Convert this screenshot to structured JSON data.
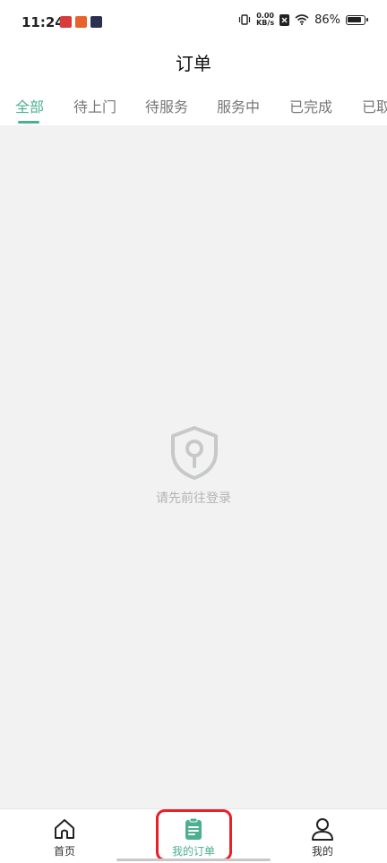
{
  "status_bar": {
    "time": "11:24",
    "net_speed_value": "0.00",
    "net_speed_unit": "KB/s",
    "battery_text": "86%",
    "battery_level": 0.86,
    "icons": [
      "app-icon-red",
      "app-icon-orange",
      "app-icon-play",
      "vibrate-icon",
      "sim-x-icon",
      "wifi-icon",
      "battery-icon"
    ]
  },
  "header": {
    "title": "订单"
  },
  "tabs": [
    {
      "label": "全部",
      "active": true
    },
    {
      "label": "待上门",
      "active": false
    },
    {
      "label": "待服务",
      "active": false
    },
    {
      "label": "服务中",
      "active": false
    },
    {
      "label": "已完成",
      "active": false
    },
    {
      "label": "已取",
      "active": false
    }
  ],
  "empty_state": {
    "icon": "shield-lock-icon",
    "message": "请先前往登录"
  },
  "bottom_nav": {
    "items": [
      {
        "label": "首页",
        "icon": "home-icon",
        "active": false
      },
      {
        "label": "我的订单",
        "icon": "clipboard-icon",
        "active": true
      },
      {
        "label": "我的",
        "icon": "user-icon",
        "active": false
      }
    ]
  },
  "colors": {
    "accent": "#4cb08f",
    "content_bg": "#f2f2f2",
    "highlight": "#e8202a"
  }
}
